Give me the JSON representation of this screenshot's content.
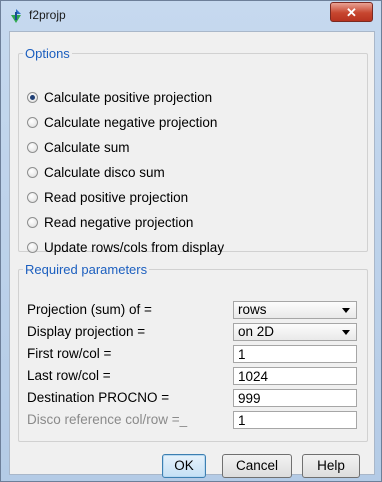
{
  "window": {
    "title": "f2projp",
    "close_glyph": "✕",
    "icon": "bruker-app-icon"
  },
  "options": {
    "legend": "Options",
    "items": [
      {
        "label": "Calculate positive projection",
        "checked": true
      },
      {
        "label": "Calculate negative projection",
        "checked": false
      },
      {
        "label": "Calculate sum",
        "checked": false
      },
      {
        "label": "Calculate disco sum",
        "checked": false
      },
      {
        "label": "Read positive projection",
        "checked": false
      },
      {
        "label": "Read negative projection",
        "checked": false
      },
      {
        "label": "Update rows/cols from display",
        "checked": false
      }
    ]
  },
  "params": {
    "legend": "Required parameters",
    "projection_label": "Projection (sum) of =",
    "projection_value": "rows",
    "display_label": "Display projection =",
    "display_value": "on 2D",
    "first_label": "First row/col =",
    "first_value": "1",
    "last_label": "Last row/col =",
    "last_value": "1024",
    "procno_label": "Destination PROCNO =",
    "procno_value": "999",
    "disco_label": "Disco reference col/row =_",
    "disco_value": "1"
  },
  "buttons": {
    "ok": "OK",
    "cancel": "Cancel",
    "help": "Help"
  }
}
